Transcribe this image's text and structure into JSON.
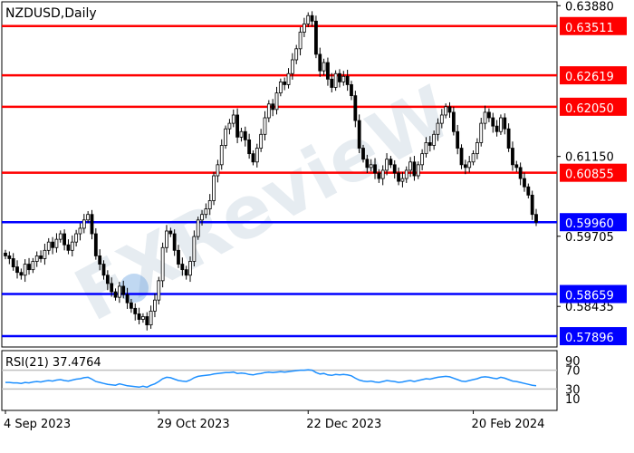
{
  "chart_data": {
    "type": "candlestick",
    "title": "NZDUSD,Daily",
    "price_axis": {
      "ylim": [
        0.577,
        0.6395
      ],
      "ticks": [
        "0.63880",
        "0.61150",
        "0.59705",
        "0.58435"
      ]
    },
    "x_ticks": [
      {
        "label": "4 Sep 2023",
        "index": 0
      },
      {
        "label": "29 Oct 2023",
        "index": 39
      },
      {
        "label": "22 Dec 2023",
        "index": 77
      },
      {
        "label": "20 Feb 2024",
        "index": 119
      }
    ],
    "levels": [
      {
        "label": "0.63511",
        "value": 0.63511,
        "color": "#ff0000"
      },
      {
        "label": "0.62619",
        "value": 0.62619,
        "color": "#ff0000"
      },
      {
        "label": "0.62050",
        "value": 0.6205,
        "color": "#ff0000"
      },
      {
        "label": "0.60855",
        "value": 0.60855,
        "color": "#ff0000"
      },
      {
        "label": "0.59960",
        "value": 0.5996,
        "color": "#0000ff"
      },
      {
        "label": "0.58659",
        "value": 0.58659,
        "color": "#0000ff"
      },
      {
        "label": "0.57896",
        "value": 0.57896,
        "color": "#0000ff"
      }
    ],
    "series_close": [
      0.5935,
      0.593,
      0.5915,
      0.5905,
      0.59,
      0.592,
      0.591,
      0.5925,
      0.5935,
      0.593,
      0.5945,
      0.596,
      0.595,
      0.5965,
      0.5975,
      0.5955,
      0.5945,
      0.596,
      0.5975,
      0.5985,
      0.6,
      0.601,
      0.5975,
      0.5935,
      0.592,
      0.59,
      0.5885,
      0.587,
      0.586,
      0.588,
      0.5865,
      0.585,
      0.584,
      0.583,
      0.582,
      0.5825,
      0.581,
      0.5835,
      0.5855,
      0.589,
      0.595,
      0.598,
      0.5975,
      0.5945,
      0.592,
      0.591,
      0.59,
      0.5925,
      0.597,
      0.6,
      0.601,
      0.602,
      0.6035,
      0.608,
      0.61,
      0.6135,
      0.6165,
      0.6175,
      0.619,
      0.615,
      0.616,
      0.6145,
      0.612,
      0.6105,
      0.613,
      0.6155,
      0.6185,
      0.621,
      0.62,
      0.623,
      0.625,
      0.6245,
      0.6265,
      0.629,
      0.631,
      0.634,
      0.6355,
      0.637,
      0.636,
      0.63,
      0.627,
      0.6285,
      0.6255,
      0.624,
      0.6265,
      0.625,
      0.626,
      0.6245,
      0.6225,
      0.618,
      0.613,
      0.611,
      0.6095,
      0.61,
      0.6085,
      0.6075,
      0.609,
      0.611,
      0.61,
      0.6085,
      0.607,
      0.6075,
      0.609,
      0.6105,
      0.608,
      0.61,
      0.612,
      0.614,
      0.6135,
      0.6155,
      0.6175,
      0.619,
      0.6205,
      0.6195,
      0.616,
      0.613,
      0.61,
      0.6095,
      0.6105,
      0.612,
      0.614,
      0.6175,
      0.6195,
      0.6185,
      0.617,
      0.616,
      0.6185,
      0.6165,
      0.613,
      0.61,
      0.6095,
      0.6075,
      0.606,
      0.6045,
      0.601,
      0.5996
    ],
    "rsi": {
      "label": "RSI(21) 37.4764",
      "ticks": [
        "90",
        "70",
        "30",
        "10"
      ],
      "ylim": [
        0,
        100
      ],
      "levels": [
        70,
        30
      ],
      "color": "#1e90ff",
      "values": [
        44,
        44,
        43,
        43,
        42,
        44,
        43,
        45,
        46,
        45,
        47,
        48,
        47,
        49,
        50,
        48,
        47,
        49,
        51,
        52,
        54,
        55,
        51,
        46,
        44,
        42,
        40,
        39,
        38,
        41,
        39,
        37,
        36,
        35,
        34,
        36,
        34,
        38,
        41,
        46,
        52,
        55,
        54,
        51,
        48,
        47,
        46,
        49,
        54,
        57,
        58,
        59,
        60,
        62,
        63,
        64,
        65,
        65,
        66,
        63,
        64,
        63,
        61,
        60,
        62,
        63,
        65,
        66,
        65,
        66,
        67,
        66,
        67,
        68,
        69,
        70,
        70,
        71,
        70,
        65,
        62,
        63,
        60,
        59,
        61,
        60,
        61,
        60,
        58,
        53,
        49,
        47,
        46,
        47,
        45,
        44,
        46,
        48,
        47,
        46,
        44,
        45,
        47,
        48,
        46,
        48,
        50,
        52,
        51,
        53,
        55,
        56,
        57,
        56,
        53,
        50,
        47,
        46,
        48,
        50,
        52,
        55,
        56,
        55,
        53,
        52,
        55,
        53,
        50,
        47,
        46,
        44,
        42,
        40,
        38,
        37
      ]
    }
  }
}
